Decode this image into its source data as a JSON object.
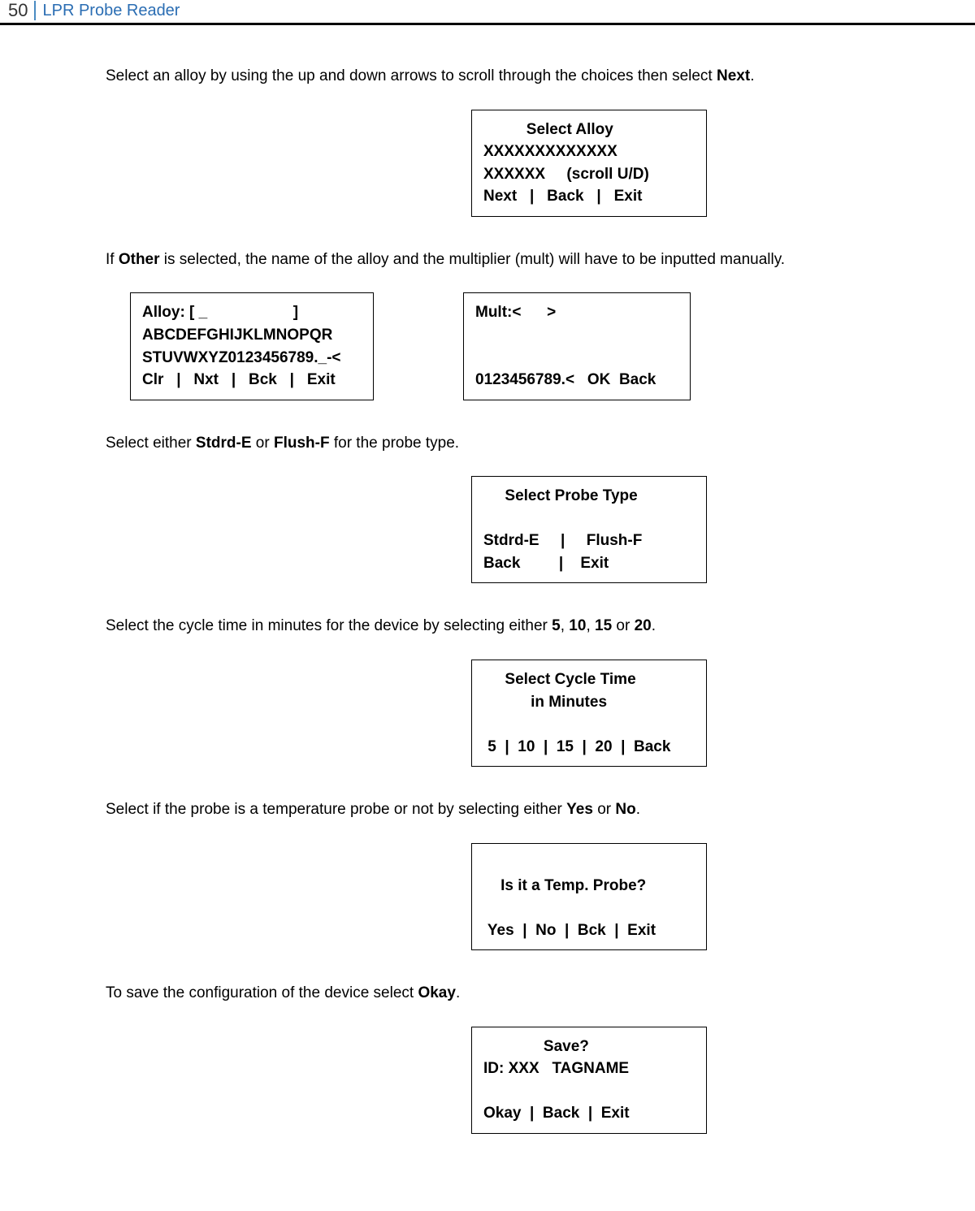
{
  "header": {
    "page_number": "50",
    "title": "LPR Probe Reader"
  },
  "p1": {
    "pre": "Select an alloy by using the up and down arrows to scroll through the choices then select ",
    "bold": "Next",
    "post": "."
  },
  "screen_alloy_select": "          Select Alloy\nXXXXXXXXXXXXX\nXXXXXX     (scroll U/D)\nNext   |   Back   |   Exit",
  "p2": {
    "pre": "If ",
    "bold": "Other",
    "post": " is selected, the name of the alloy and the multiplier (mult) will have to be inputted manually."
  },
  "screen_alloy_input": "Alloy: [ _                    ]\nABCDEFGHIJKLMNOPQR\nSTUVWXYZ0123456789._-<\nClr   |   Nxt   |   Bck   |   Exit",
  "screen_mult_input": "Mult:<      >\n\n\n0123456789.<   OK  Back",
  "p3": {
    "pre": "Select either ",
    "b1": "Stdrd-E",
    "mid": " or ",
    "b2": "Flush-F",
    "post": " for the probe type."
  },
  "screen_probe_type": "     Select Probe Type\n\nStdrd-E     |     Flush-F\nBack         |    Exit",
  "p4": {
    "pre": "Select the cycle time in minutes for the device by selecting either ",
    "b1": "5",
    "c1": ", ",
    "b2": "10",
    "c2": ", ",
    "b3": "15",
    "c3": " or ",
    "b4": "20",
    "post": "."
  },
  "screen_cycle_time": "     Select Cycle Time\n           in Minutes\n\n 5  |  10  |  15  |  20  |  Back",
  "p5": {
    "pre": "Select if the probe is a temperature probe or not by selecting either ",
    "b1": "Yes",
    "mid": " or ",
    "b2": "No",
    "post": "."
  },
  "screen_temp_probe": "\n    Is it a Temp. Probe?\n\n Yes  |  No  |  Bck  |  Exit",
  "p6": {
    "pre": "To save the configuration of the device select ",
    "bold": "Okay",
    "post": "."
  },
  "screen_save": "              Save?\nID: XXX   TAGNAME\n\nOkay  |  Back  |  Exit"
}
